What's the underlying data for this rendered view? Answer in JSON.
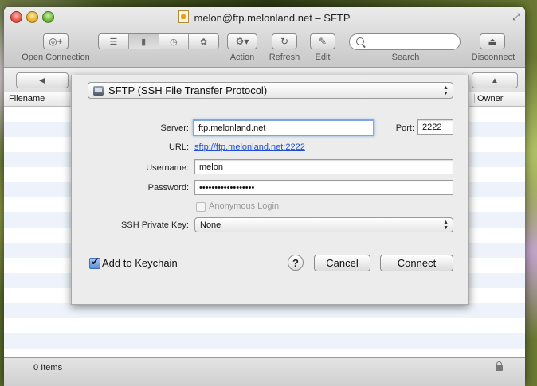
{
  "window": {
    "title": "melon@ftp.melonland.net – SFTP"
  },
  "toolbar": {
    "open_connection_label": "Open Connection",
    "action_label": "Action",
    "refresh_label": "Refresh",
    "edit_label": "Edit",
    "search_label": "Search",
    "search_placeholder": "",
    "disconnect_label": "Disconnect"
  },
  "browser": {
    "columns": [
      {
        "label": "Filename"
      },
      {
        "label": "Owner"
      }
    ]
  },
  "status": {
    "item_count": "0 Items"
  },
  "dialog": {
    "protocol": "SFTP (SSH File Transfer Protocol)",
    "server_label": "Server:",
    "server_value": "ftp.melonland.net",
    "port_label": "Port:",
    "port_value": "2222",
    "url_label": "URL:",
    "url_value": "sftp://ftp.melonland.net:2222",
    "username_label": "Username:",
    "username_value": "melon",
    "password_label": "Password:",
    "password_value": "••••••••••••••••••",
    "anonymous_label": "Anonymous Login",
    "ssh_key_label": "SSH Private Key:",
    "ssh_key_value": "None",
    "keychain_label": "Add to Keychain",
    "help_label": "?",
    "cancel_label": "Cancel",
    "connect_label": "Connect"
  }
}
